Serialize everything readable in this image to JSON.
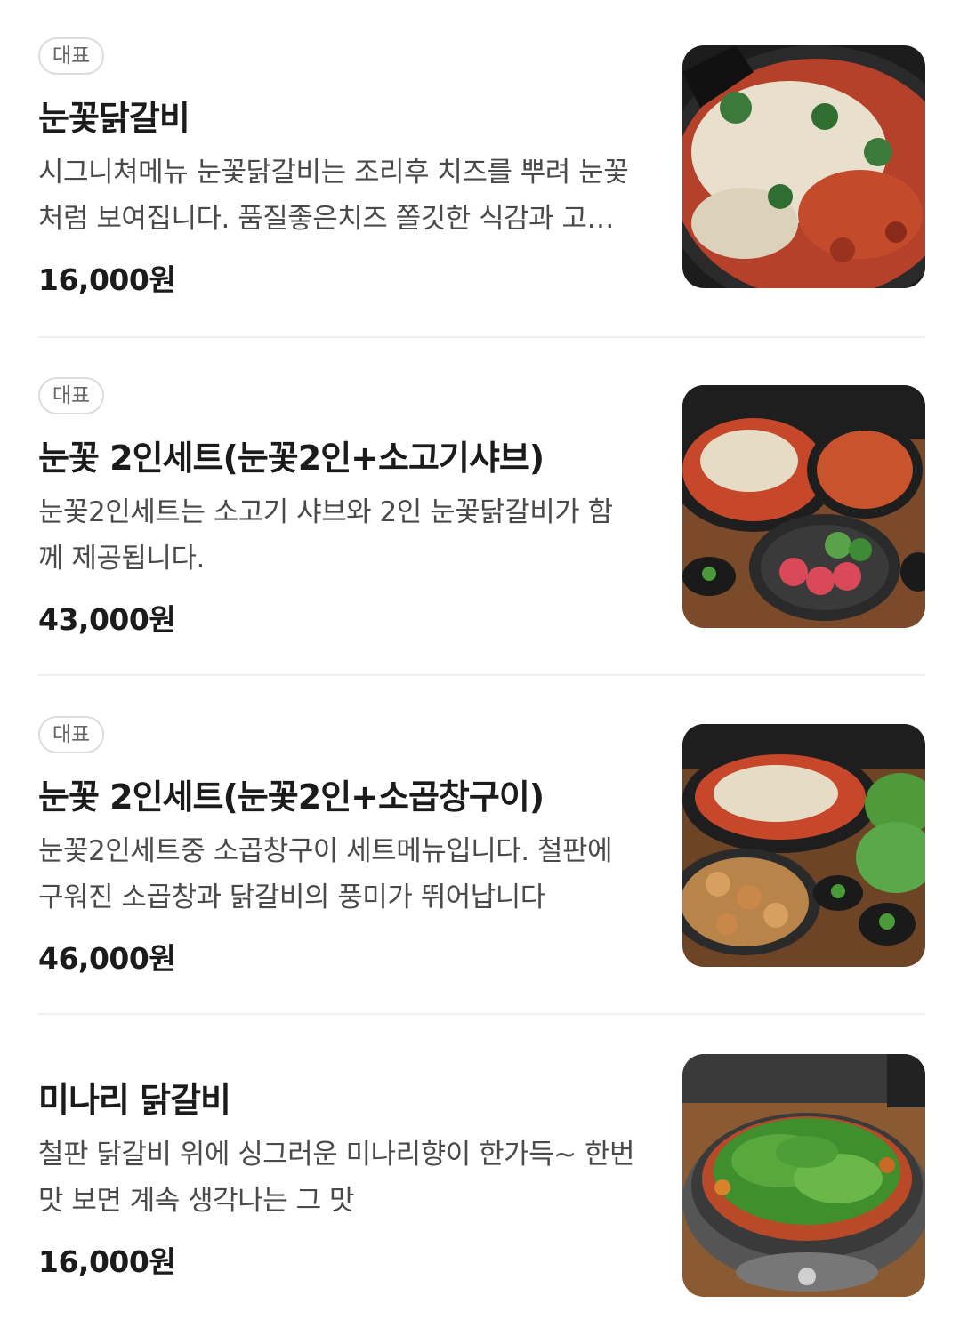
{
  "menu": {
    "items": [
      {
        "badge": "대표",
        "name": "눈꽃닭갈비",
        "description": "시그니쳐메뉴 눈꽃닭갈비는 조리후 치즈를 뿌려 눈꽃처럼 보여집니다. 품질좋은치즈 쫄깃한 식감과 고소한 맛이 일품입니다",
        "price": "16,000원",
        "image_icon": "cheese-dakgalbi-photo"
      },
      {
        "badge": "대표",
        "name": "눈꽃 2인세트(눈꽃2인+소고기샤브)",
        "description": "눈꽃2인세트는 소고기 샤브와 2인 눈꽃닭갈비가 함께 제공됩니다.",
        "price": "43,000원",
        "image_icon": "beef-shabu-set-photo"
      },
      {
        "badge": "대표",
        "name": "눈꽃 2인세트(눈꽃2인+소곱창구이)",
        "description": "눈꽃2인세트중 소곱창구이 세트메뉴입니다. 철판에 구워진 소곱창과 닭갈비의 풍미가 뛰어납니다",
        "price": "46,000원",
        "image_icon": "gopchang-set-photo"
      },
      {
        "badge": "",
        "name": "미나리 닭갈비",
        "description": "철판 닭갈비 위에 싱그러운 미나리향이 한가득~ 한번 맛 보면 계속 생각나는 그 맛",
        "price": "16,000원",
        "image_icon": "minari-dakgalbi-photo"
      }
    ]
  }
}
